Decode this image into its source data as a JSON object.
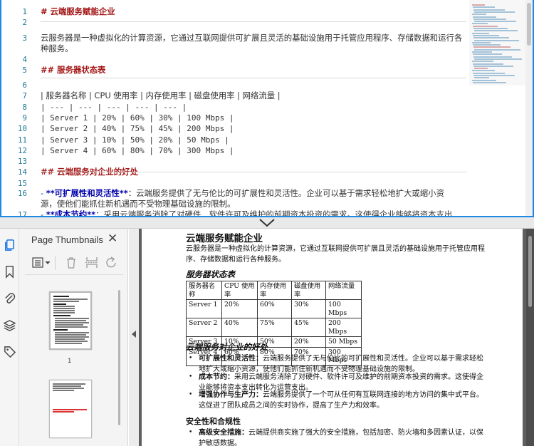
{
  "editor": {
    "lines": [
      {
        "n": "1",
        "parts": [
          {
            "cls": "md-h",
            "t": "#  云端服务赋能企业"
          }
        ]
      },
      {
        "n": "2",
        "parts": []
      },
      {
        "n": "3",
        "parts": [
          {
            "cls": "",
            "t": "云服务器是一种虚拟化的计算资源，它通过互联网提供可扩展且灵活的基础设施用于托管应用程序、存储数据和运行各"
          }
        ]
      },
      {
        "n": "",
        "parts": [
          {
            "cls": "",
            "t": "种服务。"
          }
        ]
      },
      {
        "n": "4",
        "parts": []
      },
      {
        "n": "5",
        "parts": [
          {
            "cls": "md-h",
            "t": "##  服务器状态表"
          }
        ]
      },
      {
        "n": "6",
        "parts": []
      },
      {
        "n": "7",
        "parts": [
          {
            "cls": "",
            "t": "| 服务器名称 | CPU 使用率 | 内存使用率 | 磁盘使用率 | 网络流量 |"
          }
        ]
      },
      {
        "n": "8",
        "parts": [
          {
            "cls": "mono",
            "t": "| --- | --- | --- | --- | --- |"
          }
        ]
      },
      {
        "n": "9",
        "parts": [
          {
            "cls": "mono",
            "t": "| Server 1 | 20% | 60% | 30% | 100 Mbps |"
          }
        ]
      },
      {
        "n": "10",
        "parts": [
          {
            "cls": "mono",
            "t": "| Server 2 | 40% | 75% | 45% | 200 Mbps |"
          }
        ]
      },
      {
        "n": "11",
        "parts": [
          {
            "cls": "mono",
            "t": "| Server 3 | 10% | 50% | 20% | 50 Mbps |"
          }
        ]
      },
      {
        "n": "12",
        "parts": [
          {
            "cls": "mono",
            "t": "| Server 4 | 60% | 80% | 70% | 300 Mbps |"
          }
        ]
      },
      {
        "n": "13",
        "parts": []
      },
      {
        "n": "14",
        "parts": [
          {
            "cls": "md-h",
            "t": "##  云端服务对企业的好处"
          }
        ]
      },
      {
        "n": "15",
        "parts": []
      },
      {
        "n": "16",
        "parts": [
          {
            "cls": "md-dash",
            "t": "-  "
          },
          {
            "cls": "md-bold",
            "t": "**可扩展性和灵活性**"
          },
          {
            "cls": "",
            "t": "：云端服务提供了无与伦比的可扩展性和灵活性。企业可以基于需求轻松地扩大或缩小资"
          }
        ]
      },
      {
        "n": "",
        "parts": [
          {
            "cls": "",
            "t": "源，使他们能抓住新机遇而不受物理基础设施的限制。"
          }
        ]
      },
      {
        "n": "17",
        "parts": [
          {
            "cls": "md-dash",
            "t": "-  "
          },
          {
            "cls": "md-bold",
            "t": "**成本节约**"
          },
          {
            "cls": "",
            "t": "：采用云端服务消除了对硬件、软件许可及维护的前期资本投资的需求。这使得企业能够将资本支出"
          }
        ]
      }
    ]
  },
  "thumbnails": {
    "title": "Page Thumbnails",
    "close": "✕",
    "page_number": "1"
  },
  "document": {
    "title": "云端服务赋能企业",
    "intro": "云服务器是一种虚拟化的计算资源，它通过互联网提供可扩展且灵活的基础设施用于托管应用程序、存储数据和运行各种服务。",
    "table_heading": "服务器状态表",
    "table": {
      "headers": [
        "服务器名称",
        "CPU 使用率",
        "内存使用率",
        "磁盘使用率",
        "网络流量"
      ],
      "rows": [
        [
          "Server 1",
          "20%",
          "60%",
          "30%",
          "100 Mbps"
        ],
        [
          "Server 2",
          "40%",
          "75%",
          "45%",
          "200 Mbps"
        ],
        [
          "Server 3",
          "10%",
          "50%",
          "20%",
          "50 Mbps"
        ],
        [
          "Server 4",
          "60%",
          "80%",
          "70%",
          "300 Mbps"
        ]
      ]
    },
    "benefits_heading": "云端服务对企业的好处",
    "benefits": [
      {
        "label": "可扩展性和灵活性：",
        "text": "云端服务提供了无与伦比的可扩展性和灵活性。企业可以基于需求轻松地扩大或缩小资源，使他们能抓住新机遇而不受物理基础设施的限制。"
      },
      {
        "label": "成本节约：",
        "text": "采用云端服务消除了对硬件、软件许可及维护的前期资本投资的需求。这使得企业能够将资本支出转化为运营支出。"
      },
      {
        "label": "增强协作与生产力：",
        "text": "云端服务提供了一个可从任何有互联网连接的地方访问的集中式平台。这促进了团队成员之间的实时协作，提高了生产力和效率。"
      }
    ],
    "security_heading": "安全性和合规性",
    "security": [
      {
        "label": "高级安全措施：",
        "text": "云端提供商实施了强大的安全措施，包括加密、防火墙和多因素认证，以保护敏感数据。"
      }
    ]
  }
}
